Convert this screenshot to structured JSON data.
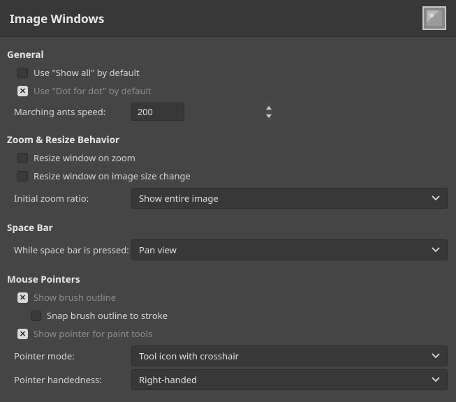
{
  "title": "Image Windows",
  "sections": {
    "general": {
      "header": "General",
      "show_all_label": "Use \"Show all\" by default",
      "show_all_checked": false,
      "dot_for_dot_label": "Use \"Dot for dot\" by default",
      "dot_for_dot_checked": true,
      "marching_ants_label": "Marching ants speed:",
      "marching_ants_value": "200"
    },
    "zoom": {
      "header": "Zoom & Resize Behavior",
      "resize_on_zoom_label": "Resize window on zoom",
      "resize_on_zoom_checked": false,
      "resize_on_size_label": "Resize window on image size change",
      "resize_on_size_checked": false,
      "initial_zoom_label": "Initial zoom ratio:",
      "initial_zoom_value": "Show entire image"
    },
    "spacebar": {
      "header": "Space Bar",
      "while_pressed_label": "While space bar is pressed:",
      "while_pressed_value": "Pan view"
    },
    "mouse": {
      "header": "Mouse Pointers",
      "show_brush_label": "Show brush outline",
      "show_brush_checked": true,
      "snap_brush_label": "Snap brush outline to stroke",
      "snap_brush_checked": false,
      "show_pointer_label": "Show pointer for paint tools",
      "show_pointer_checked": true,
      "pointer_mode_label": "Pointer mode:",
      "pointer_mode_value": "Tool icon with crosshair",
      "pointer_hand_label": "Pointer handedness:",
      "pointer_hand_value": "Right-handed"
    }
  }
}
